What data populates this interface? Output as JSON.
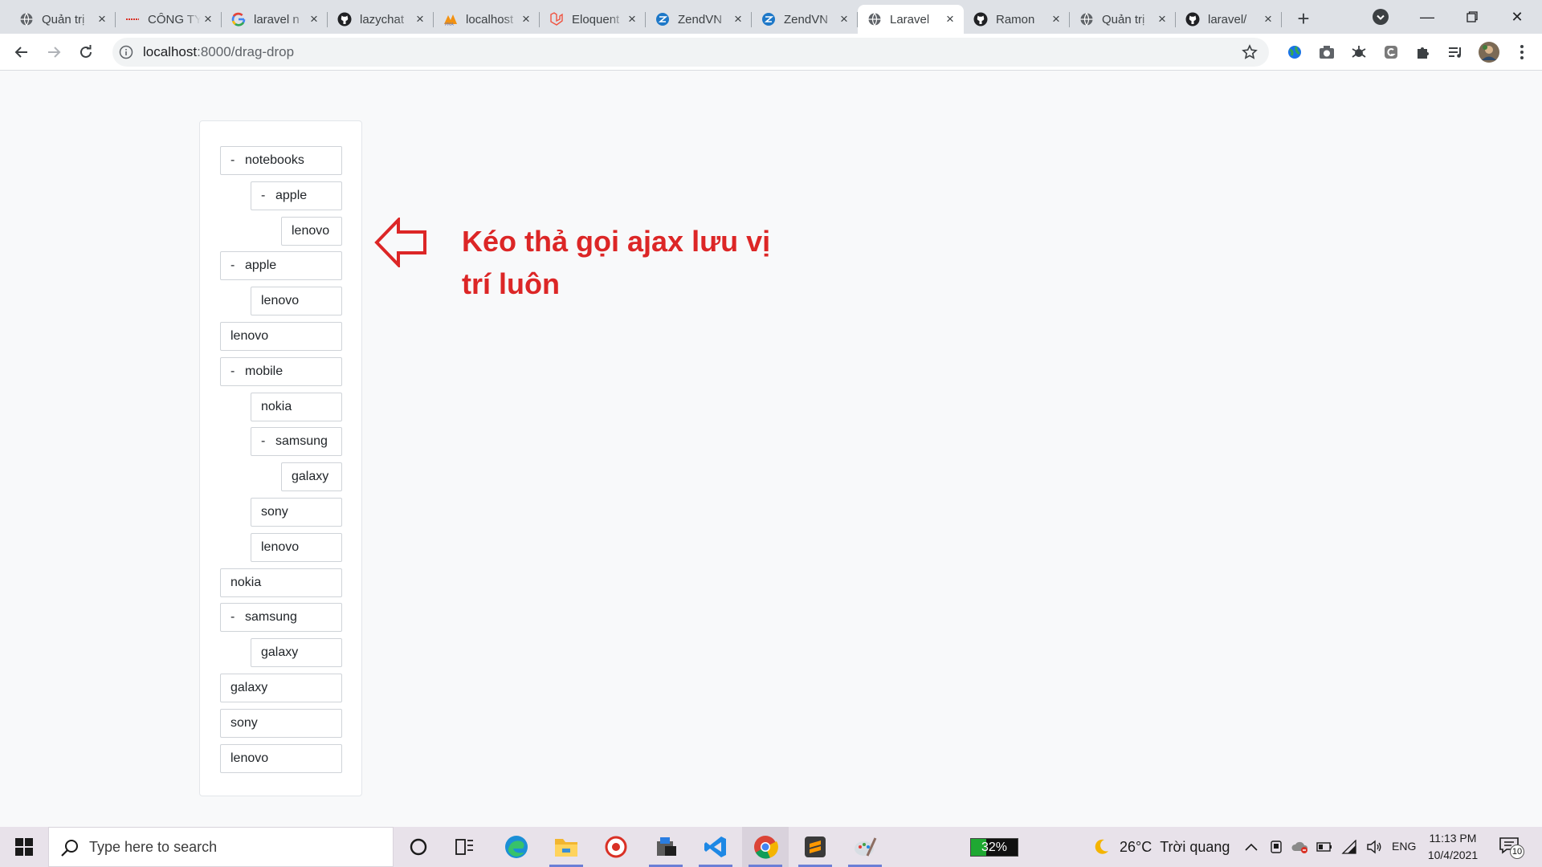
{
  "browser": {
    "tabs": [
      {
        "title": "Quản trị",
        "icon": "globe-icon"
      },
      {
        "title": "CÔNG TY",
        "icon": "brand-icon"
      },
      {
        "title": "laravel n",
        "icon": "google-icon"
      },
      {
        "title": "lazychat",
        "icon": "github-icon"
      },
      {
        "title": "localhost",
        "icon": "phpmyadmin-icon"
      },
      {
        "title": "Eloquent",
        "icon": "laravel-icon"
      },
      {
        "title": "ZendVN",
        "icon": "zendvn-icon"
      },
      {
        "title": "ZendVN",
        "icon": "zendvn-icon"
      },
      {
        "title": "Laravel",
        "icon": "globe-icon",
        "active": true
      },
      {
        "title": "Ramon",
        "icon": "github-icon"
      },
      {
        "title": "Quản trị",
        "icon": "globe-icon"
      },
      {
        "title": "laravel/",
        "icon": "github-icon"
      }
    ],
    "address": {
      "host": "localhost",
      "path": ":8000/drag-drop"
    }
  },
  "tree": [
    {
      "label": "notebooks",
      "has_children": true
    },
    {
      "label": "apple",
      "has_children": true
    },
    {
      "label": "lenovo",
      "has_children": false
    },
    {
      "label": "apple",
      "has_children": true
    },
    {
      "label": "lenovo",
      "has_children": false
    },
    {
      "label": "lenovo",
      "has_children": false
    },
    {
      "label": "mobile",
      "has_children": true
    },
    {
      "label": "nokia",
      "has_children": false
    },
    {
      "label": "samsung",
      "has_children": true
    },
    {
      "label": "galaxy",
      "has_children": false
    },
    {
      "label": "sony",
      "has_children": false
    },
    {
      "label": "lenovo",
      "has_children": false
    },
    {
      "label": "nokia",
      "has_children": false
    },
    {
      "label": "samsung",
      "has_children": true
    },
    {
      "label": "galaxy",
      "has_children": false
    },
    {
      "label": "galaxy",
      "has_children": false
    },
    {
      "label": "sony",
      "has_children": false
    },
    {
      "label": "lenovo",
      "has_children": false
    }
  ],
  "collapse_symbol": "-",
  "annotation": {
    "text": "Kéo thả gọi ajax lưu vị trí luôn",
    "color": "#dc2626"
  },
  "taskbar": {
    "search_placeholder": "Type here to search",
    "battery": "32%",
    "battery_level": 0.32,
    "weather_temp": "26°C",
    "weather_text": "Trời quang",
    "language": "ENG",
    "time": "11:13 PM",
    "date": "10/4/2021",
    "notification_count": "10"
  }
}
